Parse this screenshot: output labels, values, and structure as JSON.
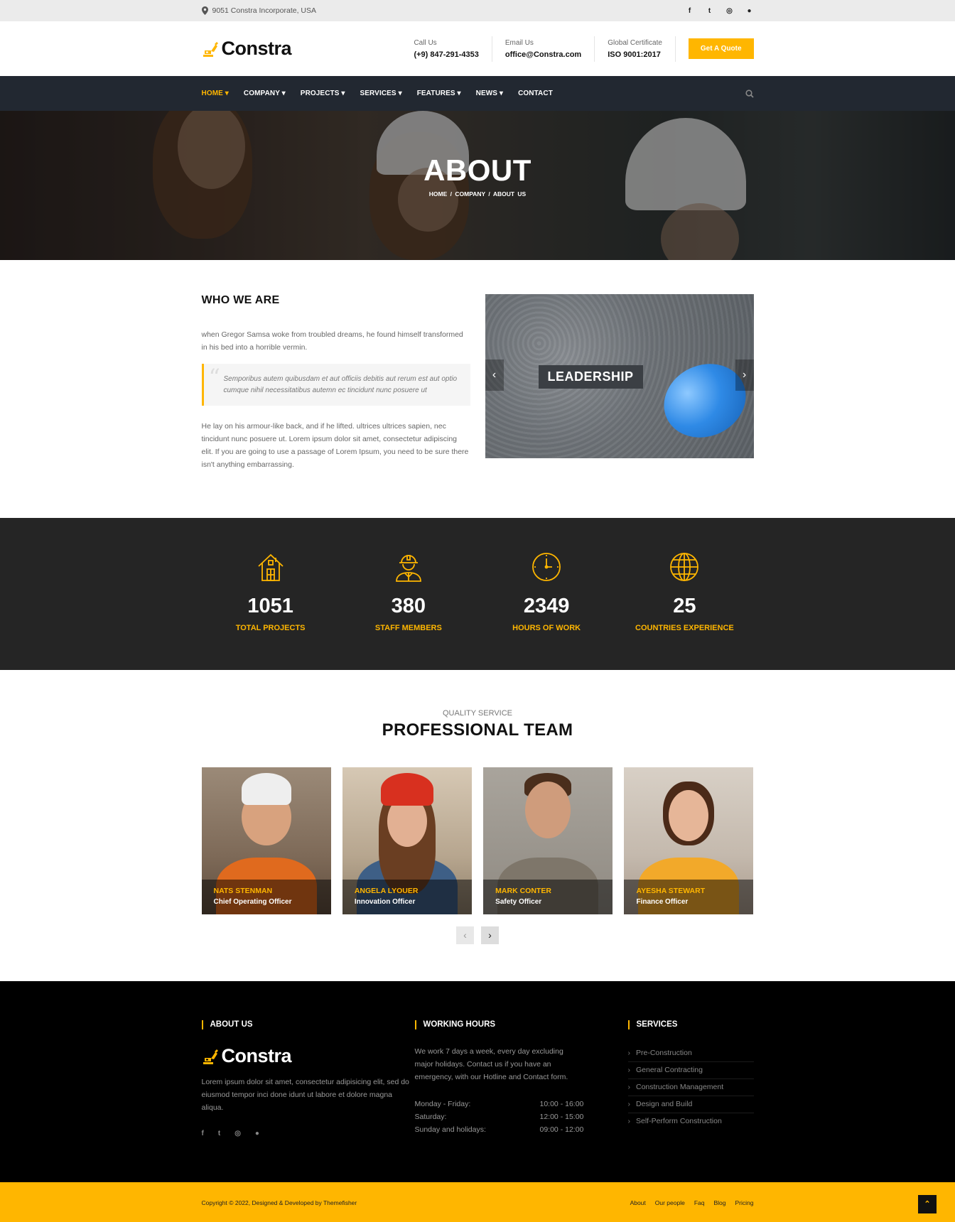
{
  "topbar": {
    "address": "9051 Constra Incorporate, USA",
    "social": [
      "f",
      "t",
      "◎",
      "●"
    ]
  },
  "header": {
    "logo_text": "Constra",
    "info": [
      {
        "label": "Call Us",
        "value": "(+9) 847-291-4353"
      },
      {
        "label": "Email Us",
        "value": "office@Constra.com"
      },
      {
        "label": "Global Certificate",
        "value": "ISO 9001:2017"
      }
    ],
    "quote_button": "Get A Quote"
  },
  "nav": {
    "items": [
      "HOME ▾",
      "COMPANY ▾",
      "PROJECTS ▾",
      "SERVICES ▾",
      "FEATURES ▾",
      "NEWS ▾",
      "CONTACT"
    ],
    "active_index": 0,
    "search_icon": "search-icon"
  },
  "hero": {
    "title": "ABOUT",
    "breadcrumb": "HOME  /  COMPANY  /  ABOUT US"
  },
  "who": {
    "heading": "WHO WE ARE",
    "intro": "when Gregor Samsa woke from troubled dreams, he found himself transformed in his bed into a horrible vermin.",
    "quote": "Semporibus autem quibusdam et aut officiis debitis aut rerum est aut optio cumque nihil necessitatibus autemn ec tincidunt nunc posuere ut",
    "body": "He lay on his armour-like back, and if he lifted. ultrices ultrices sapien, nec tincidunt nunc posuere ut. Lorem ipsum dolor sit amet, consectetur adipiscing elit. If you are going to use a passage of Lorem Ipsum, you need to be sure there isn't anything embarrassing.",
    "slider_caption": "LEADERSHIP"
  },
  "stats": [
    {
      "icon": "house-icon",
      "value": "1051",
      "label": "TOTAL PROJECTS"
    },
    {
      "icon": "worker-icon",
      "value": "380",
      "label": "STAFF MEMBERS"
    },
    {
      "icon": "clock-icon",
      "value": "2349",
      "label": "HOURS OF WORK"
    },
    {
      "icon": "globe-icon",
      "value": "25",
      "label": "COUNTRIES EXPERIENCE"
    }
  ],
  "team": {
    "subtitle": "QUALITY SERVICE",
    "title": "PROFESSIONAL TEAM",
    "members": [
      {
        "name": "NATS STENMAN",
        "role": "Chief Operating Officer"
      },
      {
        "name": "ANGELA LYOUER",
        "role": "Innovation Officer"
      },
      {
        "name": "MARK CONTER",
        "role": "Safety Officer"
      },
      {
        "name": "AYESHA STEWART",
        "role": "Finance Officer"
      }
    ],
    "prev": "‹",
    "next": "›"
  },
  "footer": {
    "about_heading": "ABOUT US",
    "logo_text": "Constra",
    "about_text": "Lorem ipsum dolor sit amet, consectetur adipisicing elit, sed do eiusmod tempor inci done idunt ut labore et dolore magna aliqua.",
    "social": [
      "f",
      "t",
      "◎",
      "●"
    ],
    "hours_heading": "WORKING HOURS",
    "hours_text": "We work 7 days a week, every day excluding major holidays. Contact us if you have an emergency, with our Hotline and Contact form.",
    "hours": [
      {
        "day": "Monday - Friday:",
        "time": "10:00 - 16:00"
      },
      {
        "day": "Saturday:",
        "time": "12:00 - 15:00"
      },
      {
        "day": "Sunday and holidays:",
        "time": "09:00 - 12:00"
      }
    ],
    "services_heading": "SERVICES",
    "services": [
      "Pre-Construction",
      "General Contracting",
      "Construction Management",
      "Design and Build",
      "Self-Perform Construction"
    ]
  },
  "copyright": {
    "text": "Copyright © 2022, Designed & Developed by Themefisher",
    "links": [
      "About",
      "Our people",
      "Faq",
      "Blog",
      "Pricing"
    ],
    "to_top": "⌃"
  },
  "colors": {
    "accent": "#ffb600",
    "nav_bg": "#222831",
    "stats_bg": "#252525",
    "footer_bg": "#000000"
  }
}
